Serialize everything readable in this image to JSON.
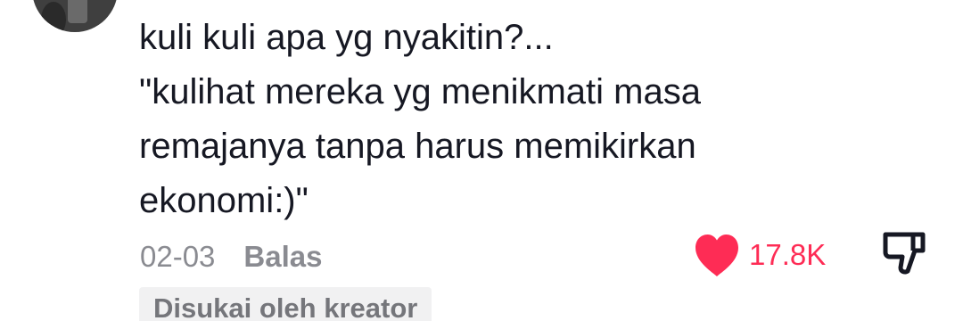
{
  "comment": {
    "text": "kuli kuli apa yg nyakitin?...\n\"kulihat mereka yg menikmati masa\nremajanya tanpa harus memikirkan\nekonomi:)\"",
    "date": "02-03",
    "reply_label": "Balas",
    "like_count": "17.8K",
    "liked": true,
    "creator_badge": "Disukai oleh kreator"
  },
  "colors": {
    "text": "#161823",
    "meta": "#8a8b91",
    "like": "#fe2c55",
    "badge_bg": "#f1f1f2",
    "badge_text": "#75767b"
  },
  "icons": {
    "like": "heart-icon",
    "dislike": "thumbs-down-icon"
  }
}
